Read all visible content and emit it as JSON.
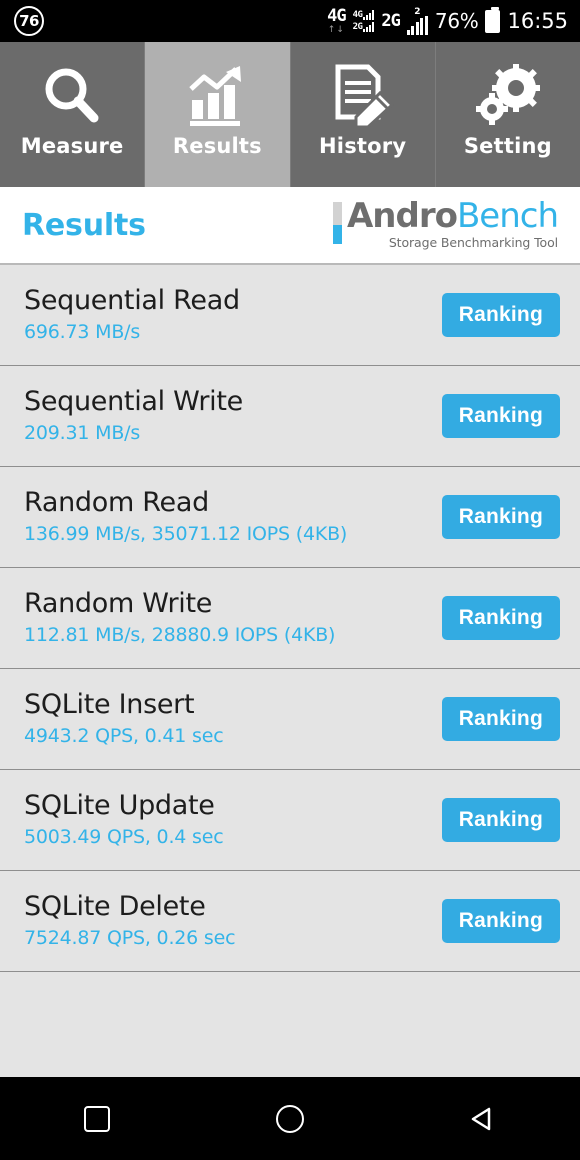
{
  "statusbar": {
    "notification_badge": "76",
    "network_4g_label": "4G",
    "network_4g_arrows": "↑↓",
    "dual_sim_top_tag": "4G",
    "dual_sim_bottom_tag": "2G",
    "network_2g_label": "2G",
    "signal_superscript": "2",
    "battery_percent": "76%",
    "battery_icon": "battery-full-icon",
    "clock": "16:55"
  },
  "tabs": [
    {
      "label": "Measure",
      "icon": "magnifier-icon",
      "active": false
    },
    {
      "label": "Results",
      "icon": "bar-chart-trend-icon",
      "active": true
    },
    {
      "label": "History",
      "icon": "document-pencil-icon",
      "active": false
    },
    {
      "label": "Setting",
      "icon": "gears-icon",
      "active": false
    }
  ],
  "header": {
    "page_title": "Results",
    "logo_andro": "Andro",
    "logo_bench": "Bench",
    "logo_tagline": "Storage Benchmarking Tool"
  },
  "colors": {
    "accent_blue": "#33b3e8",
    "button_blue": "#33abe2",
    "tab_inactive": "#6b6b6b",
    "tab_active": "#b0b0b0",
    "list_background": "#e4e4e4",
    "row_separator": "#8e8e8e",
    "title_text": "#1d1d1d",
    "logo_gray": "#6e6e6e"
  },
  "results": [
    {
      "name": "Sequential Read",
      "value": "696.73 MB/s",
      "button": "Ranking"
    },
    {
      "name": "Sequential Write",
      "value": "209.31 MB/s",
      "button": "Ranking"
    },
    {
      "name": "Random Read",
      "value": "136.99 MB/s, 35071.12 IOPS (4KB)",
      "button": "Ranking"
    },
    {
      "name": "Random Write",
      "value": "112.81 MB/s, 28880.9 IOPS (4KB)",
      "button": "Ranking"
    },
    {
      "name": "SQLite Insert",
      "value": "4943.2 QPS, 0.41 sec",
      "button": "Ranking"
    },
    {
      "name": "SQLite Update",
      "value": "5003.49 QPS, 0.4 sec",
      "button": "Ranking"
    },
    {
      "name": "SQLite Delete",
      "value": "7524.87 QPS, 0.26 sec",
      "button": "Ranking"
    }
  ],
  "navbar": [
    {
      "icon": "recents-square-icon"
    },
    {
      "icon": "home-circle-icon"
    },
    {
      "icon": "back-triangle-icon"
    }
  ]
}
